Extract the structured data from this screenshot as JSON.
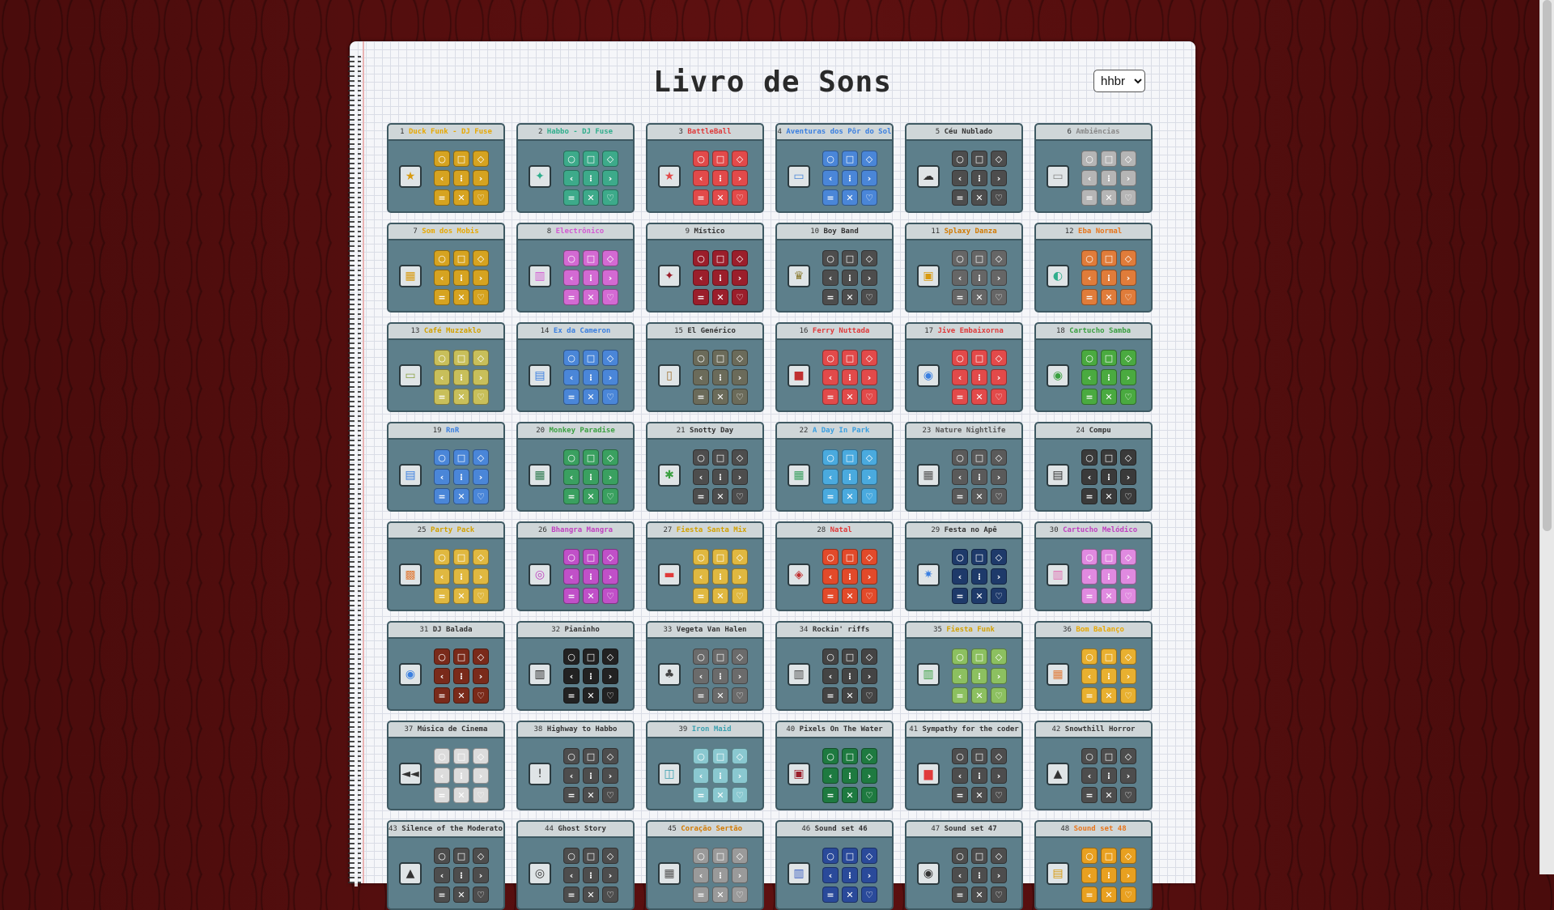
{
  "page": {
    "title": "Livro de Sons"
  },
  "hotel_select": {
    "value": "hhbr",
    "options": [
      "hhbr"
    ]
  },
  "pad_glyphs": [
    "○",
    "□",
    "◇",
    "‹",
    "⁝",
    "›",
    "=",
    "✕",
    "♡"
  ],
  "sets": [
    {
      "num": "1",
      "name": "Duck Funk - DJ Fuse",
      "name_color": "#e8a800",
      "pad_color": "#d6a320",
      "cover": "★",
      "cover_color": "#d89a10"
    },
    {
      "num": "2",
      "name": "Habbo - DJ Fuse",
      "name_color": "#2fae8c",
      "pad_color": "#3daa8a",
      "cover": "✦",
      "cover_color": "#2fae8c"
    },
    {
      "num": "3",
      "name": "BattleBall",
      "name_color": "#e03a3a",
      "pad_color": "#e24a4a",
      "cover": "★",
      "cover_color": "#e24a4a"
    },
    {
      "num": "4",
      "name": "Aventuras dos Pôr do Sol",
      "name_color": "#3a7fe0",
      "pad_color": "#4a86d8",
      "cover": "▭",
      "cover_color": "#4a86d8"
    },
    {
      "num": "5",
      "name": "Céu Nublado",
      "name_color": "#333333",
      "pad_color": "#4d4d4d",
      "cover": "☁",
      "cover_color": "#333333"
    },
    {
      "num": "6",
      "name": "Ambiências",
      "name_color": "#888888",
      "pad_color": "#b5b5b5",
      "cover": "▭",
      "cover_color": "#888888"
    },
    {
      "num": "7",
      "name": "Som dos Mobis",
      "name_color": "#e8a800",
      "pad_color": "#d6a320",
      "cover": "▦",
      "cover_color": "#d89a10"
    },
    {
      "num": "8",
      "name": "Electrônico",
      "name_color": "#d35ad3",
      "pad_color": "#d36ad3",
      "cover": "▥",
      "cover_color": "#d35ad3"
    },
    {
      "num": "9",
      "name": "Místico",
      "name_color": "#333333",
      "pad_color": "#9b1e2b",
      "cover": "✦",
      "cover_color": "#9b1e2b"
    },
    {
      "num": "10",
      "name": "Boy Band",
      "name_color": "#333333",
      "pad_color": "#4d4d4d",
      "cover": "♛",
      "cover_color": "#8a7a30"
    },
    {
      "num": "11",
      "name": "Splaxy Danza",
      "name_color": "#d37a00",
      "pad_color": "#666666",
      "cover": "▣",
      "cover_color": "#d89a10"
    },
    {
      "num": "12",
      "name": "Eba Normal",
      "name_color": "#e8751a",
      "pad_color": "#e07c3a",
      "cover": "◐",
      "cover_color": "#2fae8c"
    },
    {
      "num": "13",
      "name": "Café Muzzaklo",
      "name_color": "#d3a100",
      "pad_color": "#c8bf5a",
      "cover": "▭",
      "cover_color": "#8aa040"
    },
    {
      "num": "14",
      "name": "Ex da Cameron",
      "name_color": "#3a7fe0",
      "pad_color": "#4a86d8",
      "cover": "▤",
      "cover_color": "#3a7fe0"
    },
    {
      "num": "15",
      "name": "El Genérico",
      "name_color": "#333333",
      "pad_color": "#6b6b5a",
      "cover": "▯",
      "cover_color": "#a07030"
    },
    {
      "num": "16",
      "name": "Ferry Nuttada",
      "name_color": "#e03a3a",
      "pad_color": "#e24a4a",
      "cover": "■",
      "cover_color": "#c03030"
    },
    {
      "num": "17",
      "name": "Jive Embaixorna",
      "name_color": "#e03a3a",
      "pad_color": "#e24a4a",
      "cover": "◉",
      "cover_color": "#3a7fe0"
    },
    {
      "num": "18",
      "name": "Cartucho Samba",
      "name_color": "#3aa040",
      "pad_color": "#4aaa40",
      "cover": "◉",
      "cover_color": "#3aa040"
    },
    {
      "num": "19",
      "name": "RnR",
      "name_color": "#3a7fe0",
      "pad_color": "#4a86d8",
      "cover": "▤",
      "cover_color": "#3a7fe0"
    },
    {
      "num": "20",
      "name": "Monkey Paradise",
      "name_color": "#3aa040",
      "pad_color": "#3aa060",
      "cover": "▦",
      "cover_color": "#2f7a50"
    },
    {
      "num": "21",
      "name": "Snotty Day",
      "name_color": "#333333",
      "pad_color": "#4d4d4d",
      "cover": "✱",
      "cover_color": "#3aa040"
    },
    {
      "num": "22",
      "name": "A Day In Park",
      "name_color": "#3a9fe0",
      "pad_color": "#4aaade",
      "cover": "▦",
      "cover_color": "#3aa060"
    },
    {
      "num": "23",
      "name": "Nature Nightlife",
      "name_color": "#555555",
      "pad_color": "#5a5a5a",
      "cover": "▦",
      "cover_color": "#555555"
    },
    {
      "num": "24",
      "name": "Compu",
      "name_color": "#333333",
      "pad_color": "#3a3a3a",
      "cover": "▤",
      "cover_color": "#333333"
    },
    {
      "num": "25",
      "name": "Party Pack",
      "name_color": "#d3a100",
      "pad_color": "#e0b840",
      "cover": "▩",
      "cover_color": "#e07c3a"
    },
    {
      "num": "26",
      "name": "Bhangra Mangra",
      "name_color": "#c040c0",
      "pad_color": "#c050c8",
      "cover": "◎",
      "cover_color": "#c040c0"
    },
    {
      "num": "27",
      "name": "Fiesta Santa Mix",
      "name_color": "#d3a100",
      "pad_color": "#e0b840",
      "cover": "▬",
      "cover_color": "#e03a3a"
    },
    {
      "num": "28",
      "name": "Natal",
      "name_color": "#e03a3a",
      "pad_color": "#e24a2a",
      "cover": "◈",
      "cover_color": "#c03030"
    },
    {
      "num": "29",
      "name": "Festa no Apê",
      "name_color": "#333333",
      "pad_color": "#1e3a6a",
      "cover": "✷",
      "cover_color": "#3a7fe0"
    },
    {
      "num": "30",
      "name": "Cartucho Melódico",
      "name_color": "#c040c0",
      "pad_color": "#e08ae0",
      "cover": "▥",
      "cover_color": "#e06ab0"
    },
    {
      "num": "31",
      "name": "DJ Balada",
      "name_color": "#333333",
      "pad_color": "#7a2a1a",
      "cover": "◉",
      "cover_color": "#3a7fe0"
    },
    {
      "num": "32",
      "name": "Pianinho",
      "name_color": "#333333",
      "pad_color": "#222222",
      "cover": "▥",
      "cover_color": "#222222"
    },
    {
      "num": "33",
      "name": "Vegeta Van Halen",
      "name_color": "#333333",
      "pad_color": "#6b6b6b",
      "cover": "♣",
      "cover_color": "#444444"
    },
    {
      "num": "34",
      "name": "Rockin' riffs",
      "name_color": "#333333",
      "pad_color": "#444444",
      "cover": "▥",
      "cover_color": "#444444"
    },
    {
      "num": "35",
      "name": "Fiesta Funk",
      "name_color": "#d3a100",
      "pad_color": "#8cc060",
      "cover": "▥",
      "cover_color": "#3aa040"
    },
    {
      "num": "36",
      "name": "Bom Balanço",
      "name_color": "#e8a800",
      "pad_color": "#e8b030",
      "cover": "▦",
      "cover_color": "#e07c3a"
    },
    {
      "num": "37",
      "name": "Música de Cinema",
      "name_color": "#333333",
      "pad_color": "#dcdcdc",
      "cover": "◄◄",
      "cover_color": "#333333"
    },
    {
      "num": "38",
      "name": "Highway to Habbo",
      "name_color": "#333333",
      "pad_color": "#4d4d4d",
      "cover": "!",
      "cover_color": "#333333"
    },
    {
      "num": "39",
      "name": "Iron Maid",
      "name_color": "#3aa0b0",
      "pad_color": "#8ac8d0",
      "cover": "◫",
      "cover_color": "#3aa0b0"
    },
    {
      "num": "40",
      "name": "Pixels On The Water",
      "name_color": "#333333",
      "pad_color": "#1e7a40",
      "cover": "▣",
      "cover_color": "#9b1e2b"
    },
    {
      "num": "41",
      "name": "Sympathy for the coder",
      "name_color": "#333333",
      "pad_color": "#4d4d4d",
      "cover": "▆",
      "cover_color": "#e03a3a"
    },
    {
      "num": "42",
      "name": "Snowthill Horror",
      "name_color": "#333333",
      "pad_color": "#4d4d4d",
      "cover": "▲",
      "cover_color": "#333333"
    },
    {
      "num": "43",
      "name": "Silence of the Moderators",
      "name_color": "#333333",
      "pad_color": "#4d4d4d",
      "cover": "▲",
      "cover_color": "#333333"
    },
    {
      "num": "44",
      "name": "Ghost Story",
      "name_color": "#333333",
      "pad_color": "#4d4d4d",
      "cover": "◎",
      "cover_color": "#333333"
    },
    {
      "num": "45",
      "name": "Coração Sertão",
      "name_color": "#d37a00",
      "pad_color": "#9a9a9a",
      "cover": "▦",
      "cover_color": "#555555"
    },
    {
      "num": "46",
      "name": "Sound set 46",
      "name_color": "#333333",
      "pad_color": "#2a4a9a",
      "cover": "▥",
      "cover_color": "#3a5fc0"
    },
    {
      "num": "47",
      "name": "Sound set 47",
      "name_color": "#333333",
      "pad_color": "#4d4d4d",
      "cover": "◉",
      "cover_color": "#333333"
    },
    {
      "num": "48",
      "name": "Sound set 48",
      "name_color": "#e8751a",
      "pad_color": "#e8a020",
      "cover": "▤",
      "cover_color": "#d89a10"
    }
  ]
}
